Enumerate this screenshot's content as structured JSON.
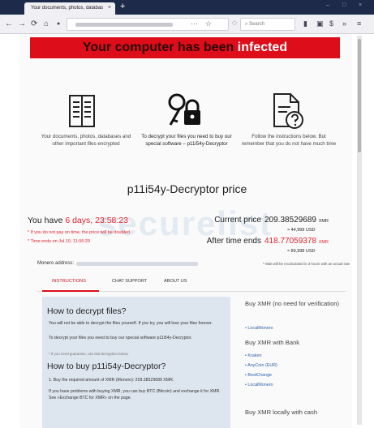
{
  "browser": {
    "tab_title": "Your documents, photos, databas",
    "tab_close": "×",
    "new_tab": "+",
    "url_more": "···",
    "search_placeholder": "Search",
    "window_controls": [
      "–",
      "□",
      "×"
    ]
  },
  "banner": {
    "text_main": "Your computer has been ",
    "text_highlight": "infected"
  },
  "columns": [
    {
      "icon": "documents-icon",
      "text": "Your documents, photos, databases and other important files encrypted"
    },
    {
      "icon": "key-lock-icon",
      "text": "To decrypt your files you need to buy our special software – p11i54y-Decryptor"
    },
    {
      "icon": "help-document-icon",
      "text": "Follow the instructions below. But remember that you do not have much time"
    }
  ],
  "product_title": "p11i54y-Decryptor price",
  "timer": {
    "label": "You have",
    "value": "6 days, 23:58:23",
    "note_double": "* If you do not pay on time, the price will be doubled",
    "note_end": "* Time ends on Jul.10, 11:06:29"
  },
  "price": {
    "current_label": "Current price",
    "current_value": "209.38529689",
    "current_unit": "XMR",
    "current_usd": "≈ 44,999 USD",
    "after_label": "After time ends",
    "after_value": "418.77059378",
    "after_unit": "XMR",
    "after_usd": "≈ 89,998 USD"
  },
  "watermark": "securelist",
  "monero": {
    "label": "Monero address:",
    "note": "* Wait will be recalculated in 3 hours with an actual rate"
  },
  "tabs": [
    "INSTRUCTIONS",
    "CHAT SUPPORT",
    "ABOUT US"
  ],
  "left_card": {
    "h1": "How to decrypt files?",
    "p1": "You will not be able to decrypt the files yourself. If you try, you will lose your files forever.",
    "p2": "To decrypt your files you need to buy our special software p11i54y-Decryptor.",
    "tiny": "* If you need guarantee, use trial decryption below.",
    "h2": "How to buy p11i54y-Decryptor?",
    "s1": "1. Buy the required amount of XMR (Monero): 209.38529689 XMR.",
    "s2": "If you have problems with buying XMR, you can buy BTC (Bitcoin) and exchange it for XMR. See «Exchange BTC for XMR» on the page."
  },
  "right": {
    "h1": "Buy XMR (no need for verification)",
    "l1": "LocalMonero",
    "h2": "Buy XMR with Bank",
    "links": [
      "Kraken",
      "AnyCoin (EUR)",
      "BestChange",
      "LocalMonero"
    ],
    "h3": "Buy XMR locally with cash"
  }
}
